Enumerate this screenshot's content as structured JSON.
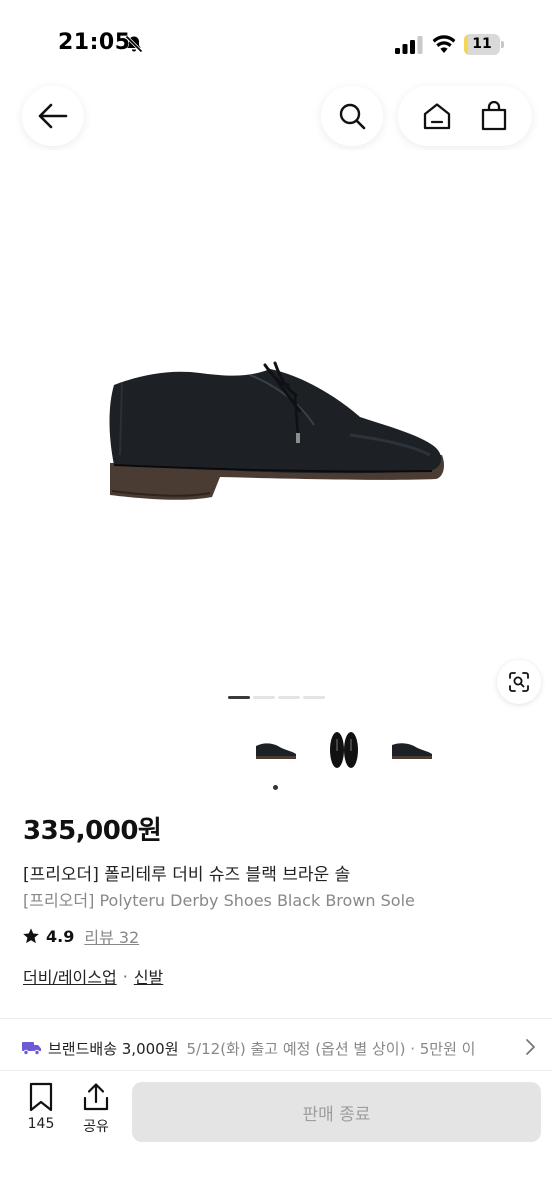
{
  "status_bar": {
    "time": "21:05",
    "battery": "11",
    "battery_level_percent": 11
  },
  "nav": {
    "back_icon": "arrow-left-icon",
    "search_icon": "search-icon",
    "home_icon": "home-icon",
    "cart_icon": "shopping-bag-icon"
  },
  "gallery": {
    "page_count": 4,
    "current_page": 1,
    "thumbnails": [
      "shoe-side",
      "shoe-pair-top",
      "shoe-side-right"
    ]
  },
  "product": {
    "price": "335,000원",
    "title_ko": "[프리오더] 폴리테루 더비 슈즈 블랙 브라운 솔",
    "title_en": "[프리오더] Polyteru Derby Shoes Black Brown Sole",
    "rating": "4.9",
    "review_label": "리뷰 32",
    "category_primary": "더비/레이스업",
    "category_separator": "·",
    "category_secondary": "신발"
  },
  "shipping": {
    "label": "브랜드배송 3,000원",
    "date_info": "5/12(화) 출고 예정 (옵션 별 상이) · 5만원 이"
  },
  "bottom_bar": {
    "bookmark_count": "145",
    "share_label": "공유",
    "sold_out_label": "판매 종료"
  },
  "colors": {
    "accent_truck": "#6b5bd6",
    "disabled_button": "#e4e4e4",
    "battery_fill": "#f3d654"
  }
}
